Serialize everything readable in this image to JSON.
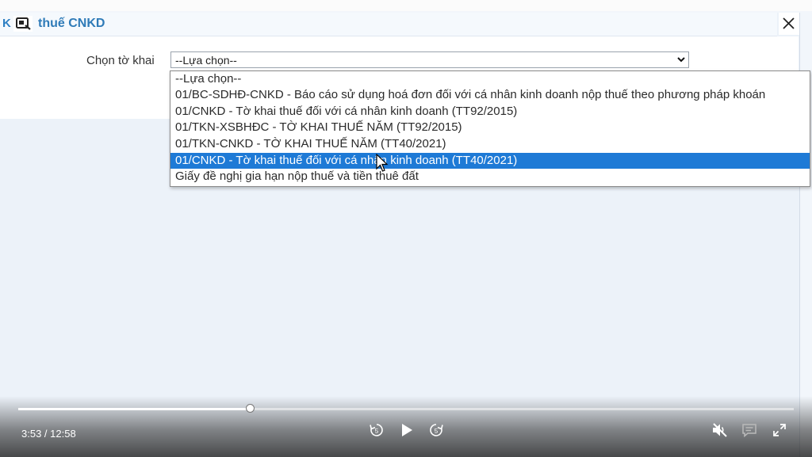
{
  "dialog": {
    "title_prefix": "K",
    "title": "thuế CNKD"
  },
  "form": {
    "label": "Chọn tờ khai",
    "select_value": "--Lựa chọn--"
  },
  "dropdown": {
    "options": [
      "--Lựa chọn--",
      "01/BC-SDHĐ-CNKD - Báo cáo sử dụng hoá đơn đối với cá nhân kinh doanh nộp thuế theo phương pháp khoán",
      "01/CNKD - Tờ khai thuế đối với cá nhân kinh doanh (TT92/2015)",
      "01/TKN-XSBHĐC - TỜ KHAI THUẾ NĂM (TT92/2015)",
      "01/TKN-CNKD - TỜ KHAI THUẾ NĂM (TT40/2021)",
      "01/CNKD - Tờ khai thuế đối với cá nhân kinh doanh (TT40/2021)",
      "Giấy đề nghị gia hạn nộp thuế và tiền thuê đất"
    ],
    "selected_index": 5
  },
  "player": {
    "time_display": "3:53 / 12:58",
    "progress": 0.3
  },
  "icons": {
    "close": "close-icon",
    "rewind": "rewind-icon",
    "play": "play-icon",
    "forward": "forward-icon",
    "mute": "muted-volume-icon",
    "captions": "captions-icon",
    "fullscreen": "fullscreen-icon",
    "capture": "screen-capture-icon",
    "cursor": "mouse-pointer-icon"
  },
  "colors": {
    "accent": "#1e7ad6",
    "title": "#2f7bb8"
  }
}
